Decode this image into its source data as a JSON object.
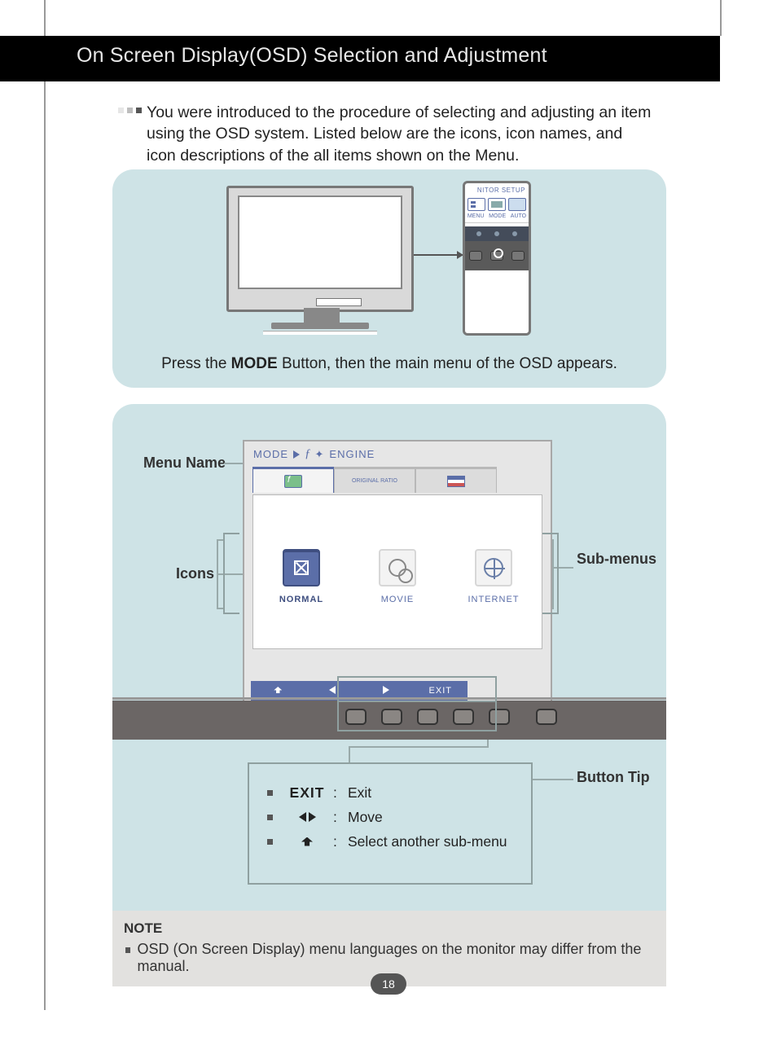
{
  "header": {
    "title": "On Screen Display(OSD) Selection and Adjustment"
  },
  "intro": "You were introduced to the procedure of selecting and adjusting an item using the OSD system. Listed below are the icons, icon names, and icon descriptions of the all items shown on the Menu.",
  "top_panel": {
    "device_title": "NITOR SETUP",
    "device_labels": [
      "MENU",
      "MODE",
      "AUTO"
    ],
    "caption_pre": "Press the ",
    "caption_bold": "MODE",
    "caption_post": " Button, then the main menu of the OSD appears."
  },
  "osd": {
    "title_pre": "MODE",
    "title_post": "ENGINE",
    "tabs": [
      "f",
      "ORIGINAL RATIO",
      " "
    ],
    "sub_items": [
      {
        "label": "NORMAL"
      },
      {
        "label": "MOVIE"
      },
      {
        "label": "INTERNET"
      }
    ],
    "nav_exit": "EXIT"
  },
  "labels": {
    "menu_name": "Menu Name",
    "icons": "Icons",
    "sub_menus": "Sub-menus",
    "button_tip": "Button Tip"
  },
  "tips": {
    "exit_key": "EXIT",
    "exit": "Exit",
    "move": "Move",
    "select": "Select another sub-menu"
  },
  "note": {
    "title": "NOTE",
    "text": "OSD (On Screen Display) menu languages on the monitor may differ from the manual."
  },
  "page_number": "18"
}
